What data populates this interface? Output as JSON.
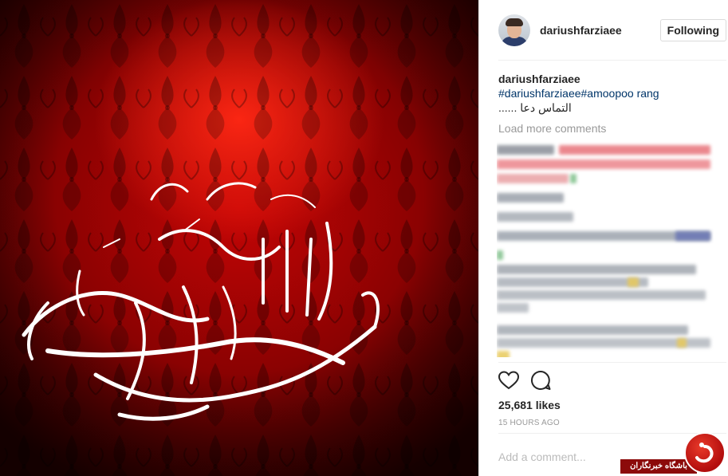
{
  "post": {
    "calligraphy_alt": "السلام علیک یا ابا عبدالله الحسین"
  },
  "header": {
    "username": "dariushfarziaee",
    "follow_label": "Following"
  },
  "caption": {
    "username": "dariushfarziaee",
    "hashtags": "#dariushfarziaee#amoopoo rang",
    "text": "التماس دعا ......"
  },
  "comments": {
    "load_more": "Load more comments"
  },
  "stats": {
    "likes": "25,681 likes",
    "time": "15 HOURS AGO"
  },
  "input": {
    "placeholder": "Add a comment..."
  },
  "watermark": {
    "label": "باشگاه خبرنگاران"
  },
  "colors": {
    "accent_red": "#c40505",
    "link": "#003569",
    "muted": "#999999"
  },
  "icons": [
    "heart-icon",
    "comment-icon"
  ]
}
